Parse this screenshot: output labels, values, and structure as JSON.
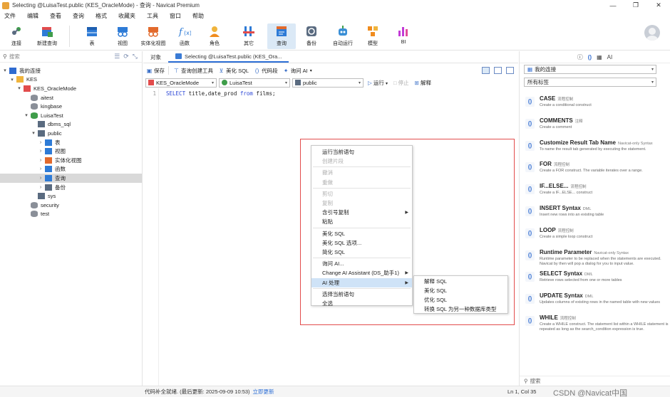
{
  "window": {
    "title": "Selecting @LuisaTest.public (KES_OracleMode) - 查询 - Navicat Premium",
    "controls": [
      "—",
      "❐",
      "✕"
    ]
  },
  "menu": [
    "文件",
    "编辑",
    "查看",
    "查询",
    "格式",
    "收藏夹",
    "工具",
    "窗口",
    "帮助"
  ],
  "toolbar": {
    "buttons": [
      {
        "label": "连接",
        "icon": "connection-icon"
      },
      {
        "label": "新建查询",
        "icon": "new-query-icon"
      },
      {
        "label": "表",
        "icon": "table-icon"
      },
      {
        "label": "视图",
        "icon": "view-icon"
      },
      {
        "label": "实体化视图",
        "icon": "materialized-view-icon"
      },
      {
        "label": "函数",
        "icon": "function-icon"
      },
      {
        "label": "角色",
        "icon": "role-icon"
      },
      {
        "label": "其它",
        "icon": "other-icon"
      },
      {
        "label": "查询",
        "icon": "query-icon"
      },
      {
        "label": "备份",
        "icon": "backup-icon"
      },
      {
        "label": "自动运行",
        "icon": "automation-icon"
      },
      {
        "label": "模型",
        "icon": "model-icon"
      },
      {
        "label": "BI",
        "icon": "bi-icon"
      }
    ]
  },
  "sidebar": {
    "search_placeholder": "搜索",
    "tree": [
      {
        "label": "我的连接",
        "level": 0,
        "icon": "connections-group-icon",
        "arrow": "▾"
      },
      {
        "label": "KES",
        "level": 1,
        "icon": "folder-icon",
        "arrow": "▾"
      },
      {
        "label": "KES_OracleMode",
        "level": 2,
        "icon": "kes-connection-icon",
        "arrow": "▾"
      },
      {
        "label": "aitest",
        "level": 3,
        "icon": "database-icon",
        "arrow": ""
      },
      {
        "label": "kingbase",
        "level": 3,
        "icon": "database-icon",
        "arrow": ""
      },
      {
        "label": "LuisaTest",
        "level": 3,
        "icon": "database-open-icon",
        "arrow": "▾"
      },
      {
        "label": "dbms_sql",
        "level": 4,
        "icon": "schema-icon",
        "arrow": ""
      },
      {
        "label": "public",
        "level": 4,
        "icon": "schema-icon",
        "arrow": "▾"
      },
      {
        "label": "表",
        "level": 5,
        "icon": "table-icon",
        "arrow": "›"
      },
      {
        "label": "视图",
        "level": 5,
        "icon": "view-icon",
        "arrow": "›"
      },
      {
        "label": "实体化视图",
        "level": 5,
        "icon": "materialized-view-icon",
        "arrow": "›"
      },
      {
        "label": "函数",
        "level": 5,
        "icon": "function-icon",
        "arrow": "›"
      },
      {
        "label": "查询",
        "level": 5,
        "icon": "query-icon",
        "arrow": "›",
        "selected": true
      },
      {
        "label": "备份",
        "level": 5,
        "icon": "backup-icon",
        "arrow": "›"
      },
      {
        "label": "sys",
        "level": 4,
        "icon": "schema-icon",
        "arrow": ""
      },
      {
        "label": "security",
        "level": 3,
        "icon": "database-icon",
        "arrow": ""
      },
      {
        "label": "test",
        "level": 3,
        "icon": "database-icon",
        "arrow": ""
      }
    ]
  },
  "tabs": {
    "objects": "对象",
    "active": "Selecting @LuisaTest.public (KES_Ora..."
  },
  "query_toolbar": {
    "save": "保存",
    "builder": "查询创建工具",
    "beautify": "美化 SQL",
    "snippet": "代码段",
    "ask_ai": "询问 AI"
  },
  "selectors": {
    "connection": "KES_OracleMode",
    "database": "LuisaTest",
    "schema": "public",
    "run": "运行",
    "stop": "停止",
    "explain": "解释"
  },
  "editor": {
    "line": "1",
    "kw_select": "SELECT",
    "cols": " title,date_prod ",
    "kw_from": "from",
    "rest": " films;"
  },
  "context_menu": {
    "items": [
      {
        "label": "运行当前语句",
        "disabled": false
      },
      {
        "label": "创建片段",
        "disabled": true
      },
      {
        "sep": true
      },
      {
        "label": "撤消",
        "disabled": true
      },
      {
        "label": "重做",
        "disabled": true
      },
      {
        "sep": true
      },
      {
        "label": "剪切",
        "disabled": true
      },
      {
        "label": "复制",
        "disabled": true
      },
      {
        "label": "含引号复制",
        "disabled": false,
        "sub": true
      },
      {
        "label": "粘贴",
        "disabled": false
      },
      {
        "sep": true
      },
      {
        "label": "美化 SQL",
        "disabled": false
      },
      {
        "label": "美化 SQL 选项...",
        "disabled": false
      },
      {
        "label": "简化 SQL",
        "disabled": false
      },
      {
        "sep": true
      },
      {
        "label": "询问 AI...",
        "disabled": false
      },
      {
        "label": "Change AI Assistant (DS_助手1)",
        "disabled": false,
        "sub": true
      },
      {
        "label": "AI 处理",
        "disabled": false,
        "sub": true,
        "highlight": true
      },
      {
        "sep": true
      },
      {
        "label": "选择当前语句",
        "disabled": false
      },
      {
        "label": "全选",
        "disabled": false
      }
    ],
    "submenu": [
      "解释 SQL",
      "美化 SQL",
      "优化 SQL",
      "转换 SQL 为另一种数据库类型"
    ]
  },
  "right_panel": {
    "connection_select": "我的连接",
    "tag_select": "所有标签",
    "search_placeholder": "搜索",
    "snippets": [
      {
        "name": "CASE",
        "tag": "流程控制",
        "desc": "Create a conditional construct"
      },
      {
        "name": "COMMENTS",
        "tag": "注释",
        "desc": "Create a comment"
      },
      {
        "name": "Customize Result Tab Name",
        "tag": "Navicat-only Syntax",
        "desc": "To name the result tab generated by executing the statement."
      },
      {
        "name": "FOR",
        "tag": "流程控制",
        "desc": "Create a FOR construct. The variable iterates over a range."
      },
      {
        "name": "IF...ELSE...",
        "tag": "流程控制",
        "desc": "Create a IF...ELSE... construct"
      },
      {
        "name": "INSERT Syntax",
        "tag": "DML",
        "desc": "Insert new rows into an existing table"
      },
      {
        "name": "LOOP",
        "tag": "流程控制",
        "desc": "Create a simple loop construct"
      },
      {
        "name": "Runtime Parameter",
        "tag": "Navicat-only Syntax",
        "desc": "Runtime parameter to be replaced when the statements are executed. Navicat by then will pop a dialog for you to input value."
      },
      {
        "name": "SELECT Syntax",
        "tag": "DML",
        "desc": "Retrieve rows selected from one or more tables"
      },
      {
        "name": "UPDATE Syntax",
        "tag": "DML",
        "desc": "Updates columns of existing rows in the named table with new values"
      },
      {
        "name": "WHILE",
        "tag": "流程控制",
        "desc": "Create a WHILE construct. The statement list within a WHILE statement is repeated as long as the search_condition expression is true."
      }
    ]
  },
  "status": {
    "left": "代码补全就绪. (最后更新: 2025-09-09 10:53)",
    "link": "立即更新",
    "position": "Ln 1, Col 35",
    "watermark": "CSDN @Navicat中国"
  },
  "colors": {
    "accent": "#2d6fd6",
    "highlight": "#cfe3f7",
    "redbox": "#e24c4c",
    "selected_row": "#d9d9d9"
  }
}
